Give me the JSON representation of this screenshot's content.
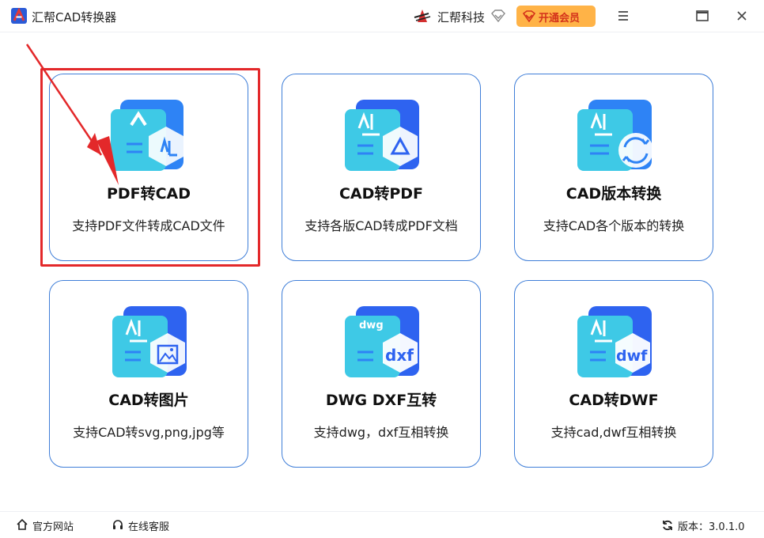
{
  "app": {
    "title": "汇帮CAD转换器"
  },
  "header": {
    "brand_name": "汇帮科技",
    "vip_label": "开通会员"
  },
  "cards": [
    {
      "title": "PDF转CAD",
      "desc": "支持PDF文件转成CAD文件"
    },
    {
      "title": "CAD转PDF",
      "desc": "支持各版CAD转成PDF文档"
    },
    {
      "title": "CAD版本转换",
      "desc": "支持CAD各个版本的转换"
    },
    {
      "title": "CAD转图片",
      "desc": "支持CAD转svg,png,jpg等"
    },
    {
      "title": "DWG DXF互转",
      "desc": "支持dwg，dxf互相转换",
      "icon_text_top": "dwg",
      "icon_text_bottom": "dxf"
    },
    {
      "title": "CAD转DWF",
      "desc": "支持cad,dwf互相转换",
      "icon_text_bottom": "dwf"
    }
  ],
  "footer": {
    "website_label": "官方网站",
    "service_label": "在线客服",
    "version_label": "版本：",
    "version": "3.0.1.0"
  },
  "colors": {
    "accent": "#3f7ed8",
    "highlight": "#e3282a",
    "vip_bg": "#ffb347",
    "vip_text": "#d4321b"
  },
  "icons": [
    "app-logo-icon",
    "brand-logo-icon",
    "diamond-icon",
    "crown-icon",
    "menu-icon",
    "maximize-icon",
    "close-icon",
    "home-icon",
    "headset-icon",
    "refresh-icon"
  ]
}
